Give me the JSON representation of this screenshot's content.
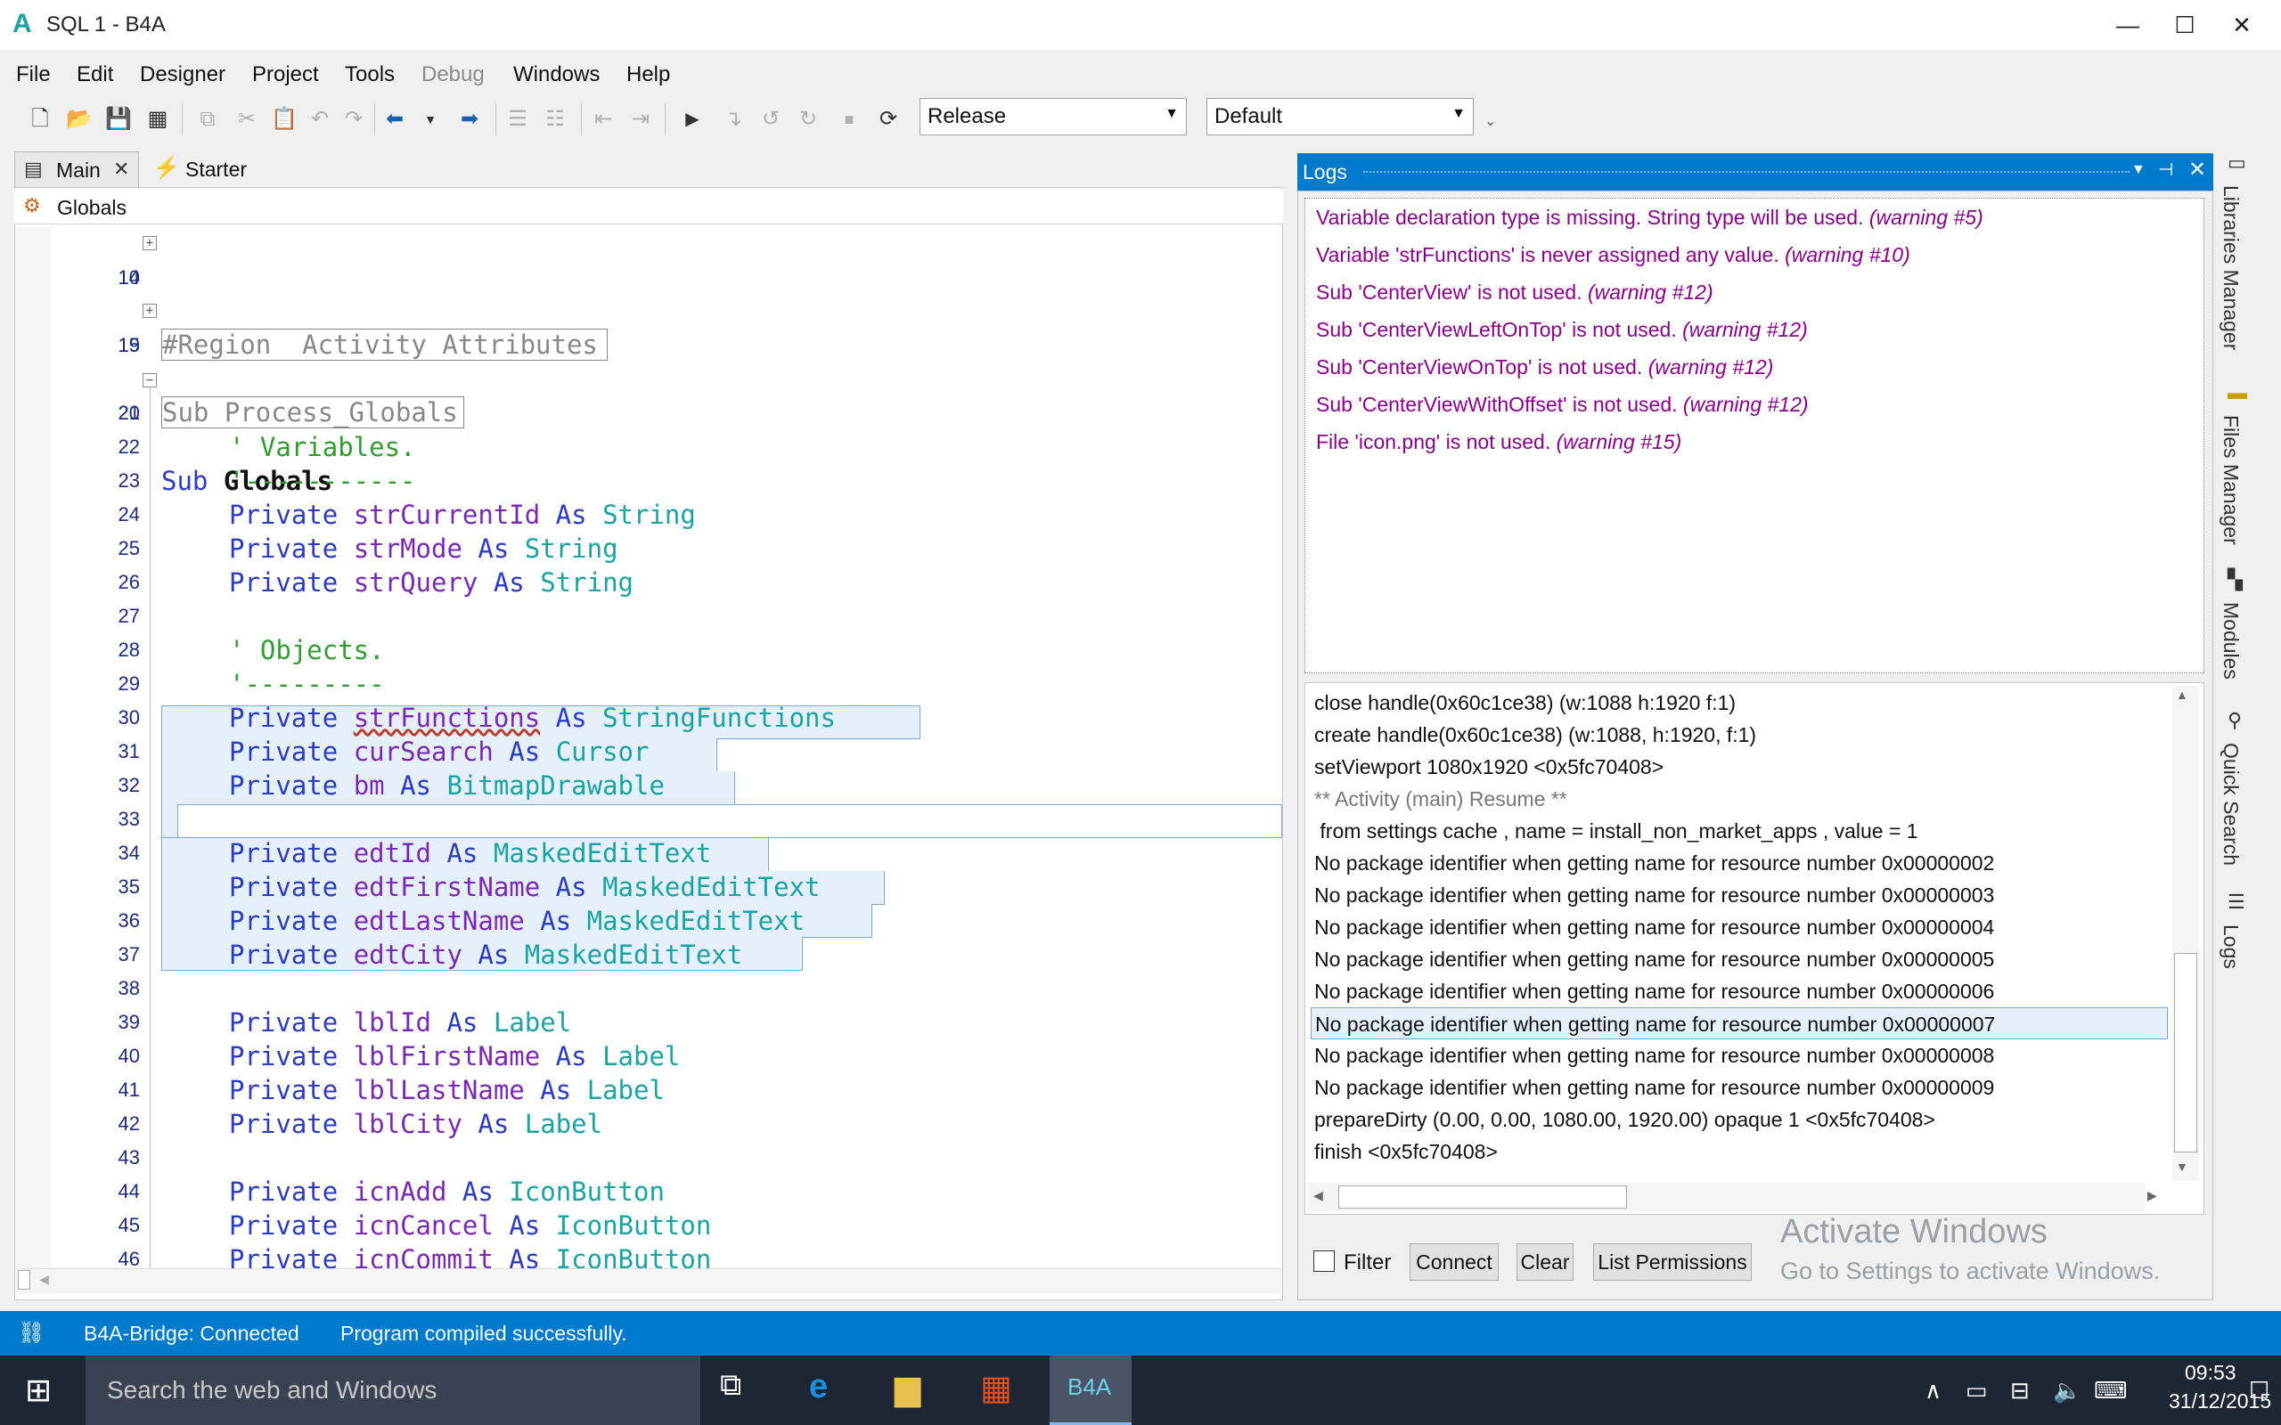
{
  "window": {
    "title": "SQL 1 - B4A",
    "app_icon": "A",
    "minimize": "—",
    "maximize": "☐",
    "close": "✕"
  },
  "menu": [
    "File",
    "Edit",
    "Designer",
    "Project",
    "Tools",
    "Debug",
    "Windows",
    "Help"
  ],
  "toolbar": {
    "build_config": "Release",
    "device": "Default"
  },
  "tabs": {
    "main": "Main",
    "starter": "Starter",
    "close_glyph": "✕"
  },
  "breadcrumb": "Globals",
  "code": {
    "region_activity": "#Region  Activity Attributes",
    "sub_process_globals": "Sub Process_Globals",
    "sub_kw": "Sub",
    "sub_name": "Globals",
    "c_vars": "' Variables.",
    "c_vars_line": "'-----------",
    "c_objs": "' Objects.",
    "c_objs_line": "'---------",
    "private": "Private",
    "as": "As",
    "lines": [
      {
        "n": "10"
      },
      {
        "n": "14"
      },
      {
        "n": "15"
      },
      {
        "n": "19"
      },
      {
        "n": "20"
      },
      {
        "n": "21"
      },
      {
        "n": "22"
      },
      {
        "n": "23"
      },
      {
        "n": "24",
        "id": "strCurrentId",
        "type": "String"
      },
      {
        "n": "25",
        "id": "strMode",
        "type": "String"
      },
      {
        "n": "26",
        "id": "strQuery",
        "type": "String"
      },
      {
        "n": "27"
      },
      {
        "n": "28"
      },
      {
        "n": "29"
      },
      {
        "n": "30",
        "id": "strFunctions",
        "type": "StringFunctions"
      },
      {
        "n": "31",
        "id": "curSearch",
        "type": "Cursor"
      },
      {
        "n": "32",
        "id": "bm",
        "type": "BitmapDrawable"
      },
      {
        "n": "33"
      },
      {
        "n": "34",
        "id": "edtId",
        "type": "MaskedEditText"
      },
      {
        "n": "35",
        "id": "edtFirstName",
        "type": "MaskedEditText"
      },
      {
        "n": "36",
        "id": "edtLastName",
        "type": "MaskedEditText"
      },
      {
        "n": "37",
        "id": "edtCity",
        "type": "MaskedEditText"
      },
      {
        "n": "38"
      },
      {
        "n": "39",
        "id": "lblId",
        "type": "Label"
      },
      {
        "n": "40",
        "id": "lblFirstName",
        "type": "Label"
      },
      {
        "n": "41",
        "id": "lblLastName",
        "type": "Label"
      },
      {
        "n": "42",
        "id": "lblCity",
        "type": "Label"
      },
      {
        "n": "43"
      },
      {
        "n": "44",
        "id": "icnAdd",
        "type": "IconButton"
      },
      {
        "n": "45",
        "id": "icnCancel",
        "type": "IconButton"
      },
      {
        "n": "46",
        "id": "icnCommit",
        "type": "IconButton"
      }
    ]
  },
  "logs": {
    "title": "Logs",
    "warnings": [
      {
        "text": "Variable declaration type is missing. String type will be used. ",
        "code": "(warning #5)"
      },
      {
        "text": "Variable 'strFunctions' is never assigned any value. ",
        "code": "(warning #10)"
      },
      {
        "text": "Sub 'CenterView' is not used. ",
        "code": "(warning #12)"
      },
      {
        "text": "Sub 'CenterViewLeftOnTop' is not used. ",
        "code": "(warning #12)"
      },
      {
        "text": "Sub 'CenterViewOnTop' is not used. ",
        "code": "(warning #12)"
      },
      {
        "text": "Sub 'CenterViewWithOffset' is not used. ",
        "code": "(warning #12)"
      },
      {
        "text": "File 'icon.png' is not used. ",
        "code": "(warning #15)"
      }
    ],
    "entries": [
      "close handle(0x60c1ce38) (w:1088 h:1920 f:1)",
      "create handle(0x60c1ce38) (w:1088, h:1920, f:1)",
      "setViewport 1080x1920 <0x5fc70408>",
      "** Activity (main) Resume **",
      " from settings cache , name = install_non_market_apps , value = 1",
      "No package identifier when getting name for resource number 0x00000002",
      "No package identifier when getting name for resource number 0x00000003",
      "No package identifier when getting name for resource number 0x00000004",
      "No package identifier when getting name for resource number 0x00000005",
      "No package identifier when getting name for resource number 0x00000006",
      "No package identifier when getting name for resource number 0x00000007",
      "No package identifier when getting name for resource number 0x00000008",
      "No package identifier when getting name for resource number 0x00000009",
      "prepareDirty (0.00, 0.00, 1080.00, 1920.00) opaque 1 <0x5fc70408>",
      "finish <0x5fc70408>"
    ],
    "filter_label": "Filter",
    "connect_button": "Connect",
    "clear_button": "Clear",
    "list_permissions_button": "List Permissions"
  },
  "side_tabs": [
    "Libraries Manager",
    "Files Manager",
    "Modules",
    "Quick Search",
    "Logs"
  ],
  "watermark": {
    "line1": "Activate Windows",
    "line2": "Go to Settings to activate Windows."
  },
  "status": {
    "bridge": "B4A-Bridge: Connected",
    "message": "Program compiled successfully."
  },
  "taskbar": {
    "search_placeholder": "Search the web and Windows",
    "b4a_label": "B4A",
    "time": "09:53",
    "date": "31/12/2015"
  },
  "colors": {
    "accent": "#007acc",
    "warning": "#8b008b",
    "keyword": "#2b3cc4",
    "type": "#1aa3a3",
    "identifier": "#7a28b8",
    "comment": "#2f9e2f"
  }
}
